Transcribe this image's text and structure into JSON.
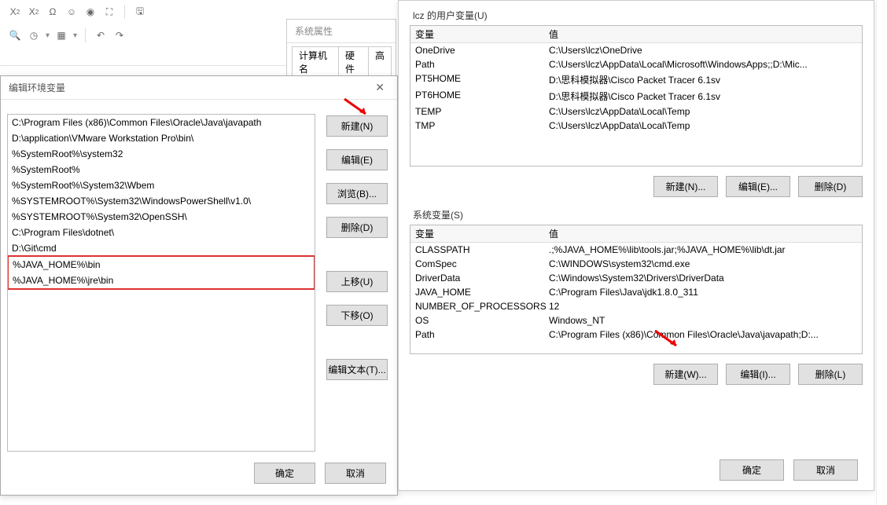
{
  "toolbar": {
    "icons": [
      "subscript",
      "superscript",
      "omega",
      "smiley",
      "eye",
      "expand",
      "save",
      "magnify",
      "clock",
      "grid",
      "undo",
      "redo"
    ]
  },
  "sysprops": {
    "title": "系统属性",
    "tabs": [
      "计算机名",
      "硬件",
      "高"
    ]
  },
  "editDialog": {
    "title": "编辑环境变量",
    "paths": [
      "C:\\Program Files (x86)\\Common Files\\Oracle\\Java\\javapath",
      "D:\\application\\VMware Workstation Pro\\bin\\",
      "%SystemRoot%\\system32",
      "%SystemRoot%",
      "%SystemRoot%\\System32\\Wbem",
      "%SYSTEMROOT%\\System32\\WindowsPowerShell\\v1.0\\",
      "%SYSTEMROOT%\\System32\\OpenSSH\\",
      "C:\\Program Files\\dotnet\\",
      "D:\\Git\\cmd",
      "%JAVA_HOME%\\bin",
      "%JAVA_HOME%\\jre\\bin"
    ],
    "highlightStart": 9,
    "highlightEnd": 10,
    "buttons": {
      "new": "新建(N)",
      "edit": "编辑(E)",
      "browse": "浏览(B)...",
      "delete": "删除(D)",
      "up": "上移(U)",
      "down": "下移(O)",
      "editText": "编辑文本(T)...",
      "ok": "确定",
      "cancel": "取消"
    }
  },
  "envDialog": {
    "userLabel": "lcz 的用户变量(U)",
    "columns": {
      "var": "变量",
      "val": "值"
    },
    "userVars": [
      {
        "name": "OneDrive",
        "value": "C:\\Users\\lcz\\OneDrive"
      },
      {
        "name": "Path",
        "value": "C:\\Users\\lcz\\AppData\\Local\\Microsoft\\WindowsApps;;D:\\Mic..."
      },
      {
        "name": "PT5HOME",
        "value": "D:\\思科模拟器\\Cisco Packet Tracer 6.1sv"
      },
      {
        "name": "PT6HOME",
        "value": "D:\\思科模拟器\\Cisco Packet Tracer 6.1sv"
      },
      {
        "name": "TEMP",
        "value": "C:\\Users\\lcz\\AppData\\Local\\Temp"
      },
      {
        "name": "TMP",
        "value": "C:\\Users\\lcz\\AppData\\Local\\Temp"
      }
    ],
    "userButtons": {
      "new": "新建(N)...",
      "edit": "编辑(E)...",
      "delete": "删除(D)"
    },
    "sysLabel": "系统变量(S)",
    "sysVars": [
      {
        "name": "CLASSPATH",
        "value": ".;%JAVA_HOME%\\lib\\tools.jar;%JAVA_HOME%\\lib\\dt.jar"
      },
      {
        "name": "ComSpec",
        "value": "C:\\WINDOWS\\system32\\cmd.exe"
      },
      {
        "name": "DriverData",
        "value": "C:\\Windows\\System32\\Drivers\\DriverData"
      },
      {
        "name": "JAVA_HOME",
        "value": "C:\\Program Files\\Java\\jdk1.8.0_311"
      },
      {
        "name": "NUMBER_OF_PROCESSORS",
        "value": "12"
      },
      {
        "name": "OS",
        "value": "Windows_NT"
      },
      {
        "name": "Path",
        "value": "C:\\Program Files (x86)\\Common Files\\Oracle\\Java\\javapath;D:..."
      }
    ],
    "sysButtons": {
      "new": "新建(W)...",
      "edit": "编辑(I)...",
      "delete": "删除(L)"
    },
    "footer": {
      "ok": "确定",
      "cancel": "取消"
    }
  }
}
